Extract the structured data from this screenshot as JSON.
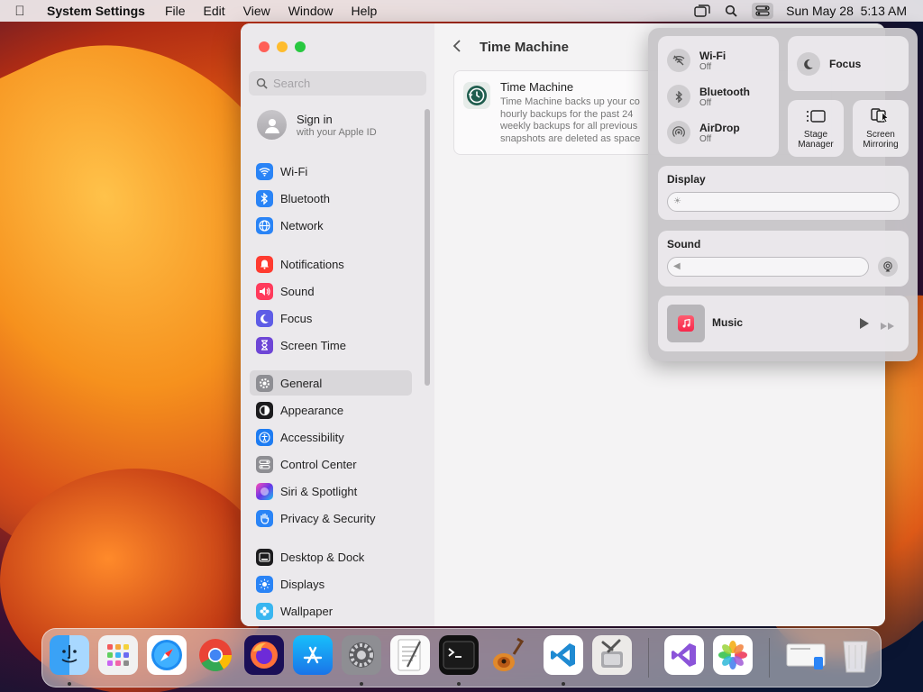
{
  "menubar": {
    "app_name": "System Settings",
    "menus": [
      "File",
      "Edit",
      "View",
      "Window",
      "Help"
    ],
    "datetime": "Sun May 28  5:13 AM"
  },
  "sidebar": {
    "search_placeholder": "Search",
    "signin": {
      "title": "Sign in",
      "subtitle": "with your Apple ID"
    },
    "items": [
      {
        "label": "Wi-Fi",
        "icon": "wifi-icon",
        "color": "#2a84f6"
      },
      {
        "label": "Bluetooth",
        "icon": "bluetooth-icon",
        "color": "#2a84f6"
      },
      {
        "label": "Network",
        "icon": "globe-icon",
        "color": "#2a84f6"
      },
      {
        "label": "Notifications",
        "icon": "bell-icon",
        "color": "#ff3b30"
      },
      {
        "label": "Sound",
        "icon": "speaker-icon",
        "color": "#ff3b5c"
      },
      {
        "label": "Focus",
        "icon": "moon-icon",
        "color": "#5e5ce6"
      },
      {
        "label": "Screen Time",
        "icon": "hourglass-icon",
        "color": "#6e46d6"
      },
      {
        "label": "General",
        "icon": "gear-icon",
        "color": "#8e8e93"
      },
      {
        "label": "Appearance",
        "icon": "appearance-icon",
        "color": "#1c1c1e"
      },
      {
        "label": "Accessibility",
        "icon": "accessibility-icon",
        "color": "#1e7cf2"
      },
      {
        "label": "Control Center",
        "icon": "toggles-icon",
        "color": "#8e8e93"
      },
      {
        "label": "Siri & Spotlight",
        "icon": "siri-icon",
        "color": "#b03cd8"
      },
      {
        "label": "Privacy & Security",
        "icon": "hand-icon",
        "color": "#2a84f6"
      },
      {
        "label": "Desktop & Dock",
        "icon": "dock-icon",
        "color": "#1c1c1e"
      },
      {
        "label": "Displays",
        "icon": "sun-icon",
        "color": "#2a84f6"
      },
      {
        "label": "Wallpaper",
        "icon": "flower-icon",
        "color": "#39b6f0"
      }
    ]
  },
  "content": {
    "title": "Time Machine",
    "card": {
      "title": "Time Machine",
      "description": "Time Machine backs up your co hourly backups for the past 24 weekly backups for all previous snapshots are deleted as space"
    }
  },
  "control_center": {
    "wifi": {
      "title": "Wi-Fi",
      "status": "Off"
    },
    "bluetooth": {
      "title": "Bluetooth",
      "status": "Off"
    },
    "airdrop": {
      "title": "AirDrop",
      "status": "Off"
    },
    "focus": "Focus",
    "stage_manager": [
      "Stage",
      "Manager"
    ],
    "screen_mirroring": [
      "Screen",
      "Mirroring"
    ],
    "display": {
      "label": "Display",
      "level": 0.0
    },
    "sound": {
      "label": "Sound",
      "level": 0.0
    },
    "music": "Music"
  },
  "dock": {
    "apps": [
      "finder",
      "launchpad",
      "safari",
      "chrome",
      "firefox",
      "app-store",
      "system-settings",
      "textedit",
      "terminal",
      "garageband",
      "vscode",
      "disk-utility",
      "visual-studio",
      "photos"
    ],
    "running": [
      "finder",
      "system-settings",
      "terminal",
      "vscode"
    ]
  }
}
